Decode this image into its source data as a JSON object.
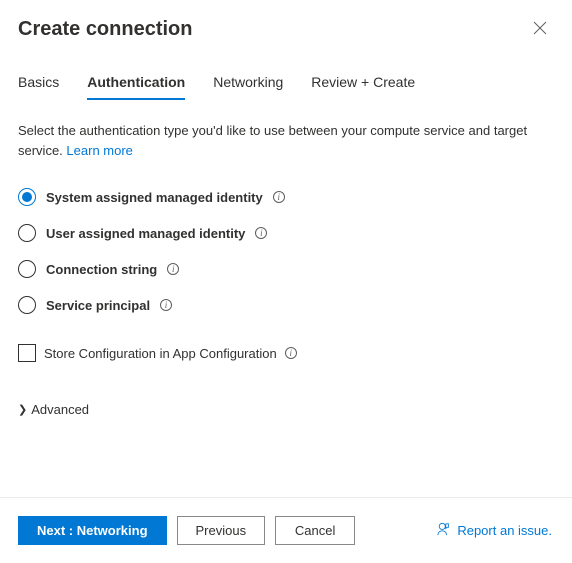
{
  "header": {
    "title": "Create connection"
  },
  "tabs": [
    {
      "label": "Basics",
      "active": false
    },
    {
      "label": "Authentication",
      "active": true
    },
    {
      "label": "Networking",
      "active": false
    },
    {
      "label": "Review + Create",
      "active": false
    }
  ],
  "description": {
    "text": "Select the authentication type you'd like to use between your compute service and target service.",
    "learn_more": "Learn more"
  },
  "auth_options": [
    {
      "label": "System assigned managed identity",
      "checked": true
    },
    {
      "label": "User assigned managed identity",
      "checked": false
    },
    {
      "label": "Connection string",
      "checked": false
    },
    {
      "label": "Service principal",
      "checked": false
    }
  ],
  "store_config": {
    "label": "Store Configuration in App Configuration",
    "checked": false
  },
  "advanced_label": "Advanced",
  "footer": {
    "next": "Next : Networking",
    "previous": "Previous",
    "cancel": "Cancel",
    "report": "Report an issue."
  }
}
